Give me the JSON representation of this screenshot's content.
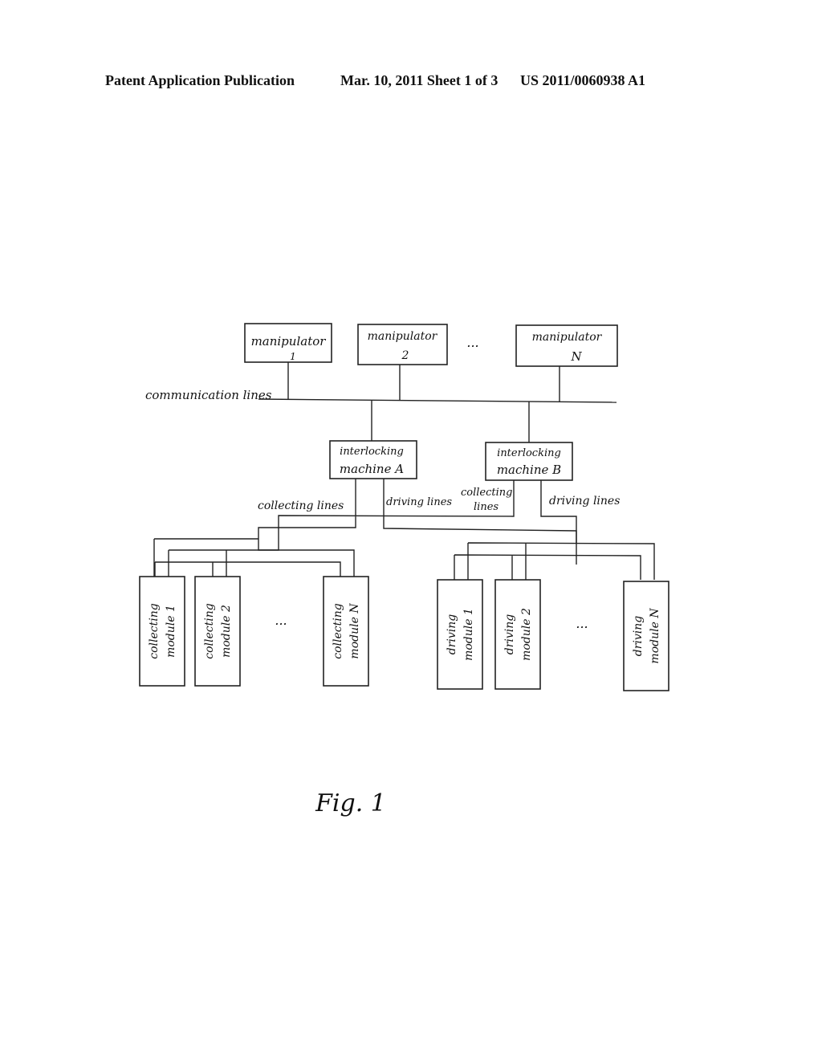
{
  "header": {
    "left": "Patent Application Publication",
    "middle": "Mar. 10, 2011  Sheet 1 of 3",
    "right": "US 2011/0060938 A1"
  },
  "figure": {
    "caption": "Fig. 1",
    "bus_label": "communication lines",
    "manipulators": [
      {
        "line1": "manipulator",
        "line2": "1"
      },
      {
        "line1": "manipulator",
        "line2": "2"
      },
      {
        "line1": "manipulator",
        "line2": "N"
      }
    ],
    "manipulator_ellipsis": "...",
    "interlocking_machines": [
      {
        "line1": "interlocking",
        "line2": "machine A"
      },
      {
        "line1": "interlocking",
        "line2": "machine B"
      }
    ],
    "line_labels": {
      "a_collecting": "collecting lines",
      "a_driving": "driving lines",
      "b_collecting_1": "collecting",
      "b_collecting_2": "lines",
      "b_driving": "driving lines"
    },
    "collecting_modules": [
      {
        "line1": "collecting",
        "line2": "module 1"
      },
      {
        "line1": "collecting",
        "line2": "module 2"
      },
      {
        "line1": "collecting",
        "line2": "module N"
      }
    ],
    "driving_modules": [
      {
        "line1": "driving",
        "line2": "module 1"
      },
      {
        "line1": "driving",
        "line2": "module 2"
      },
      {
        "line1": "driving",
        "line2": "module N"
      }
    ],
    "module_ellipsis": "..."
  }
}
